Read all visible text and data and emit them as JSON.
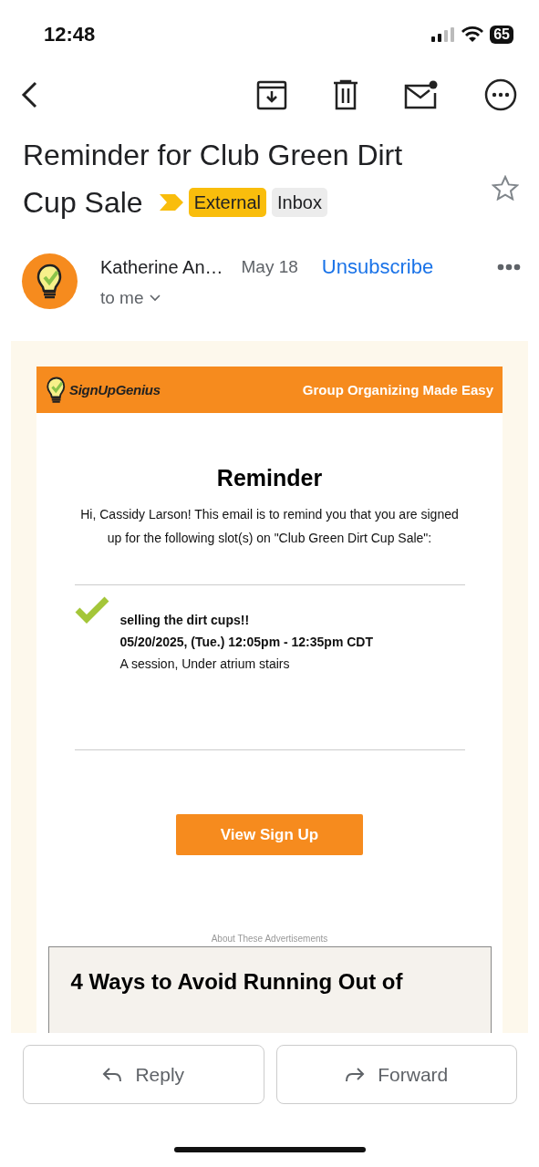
{
  "status_bar": {
    "time": "12:48",
    "battery": "65"
  },
  "subject": {
    "title_lines": [
      "Reminder for Club Green Dirt",
      "Cup Sale"
    ],
    "important": true,
    "starred": false,
    "labels": [
      {
        "text": "External",
        "kind": "warning"
      },
      {
        "text": "Inbox",
        "kind": "plain"
      }
    ]
  },
  "sender": {
    "name": "Katherine An…",
    "date": "May 18",
    "recipient": "to me",
    "unsubscribe": "Unsubscribe"
  },
  "email": {
    "brand": "SignUpGenius",
    "tagline": "Group Organizing Made Easy",
    "heading": "Reminder",
    "intro": "Hi, Cassidy Larson! This email is to remind you that you are signed up for the following slot(s) on \"Club Green Dirt Cup Sale\":",
    "slot": {
      "checked": true,
      "title": "selling the dirt cups!!",
      "time": "05/20/2025, (Tue.) 12:05pm - 12:35pm CDT",
      "location": "A session, Under atrium stairs"
    },
    "button": "View Sign Up",
    "ad_label": "About These Advertisements",
    "ad_title": "4 Ways to Avoid Running Out of"
  },
  "actions": [
    {
      "label": "Reply",
      "kind": "reply"
    },
    {
      "label": "Forward",
      "kind": "forward"
    }
  ]
}
